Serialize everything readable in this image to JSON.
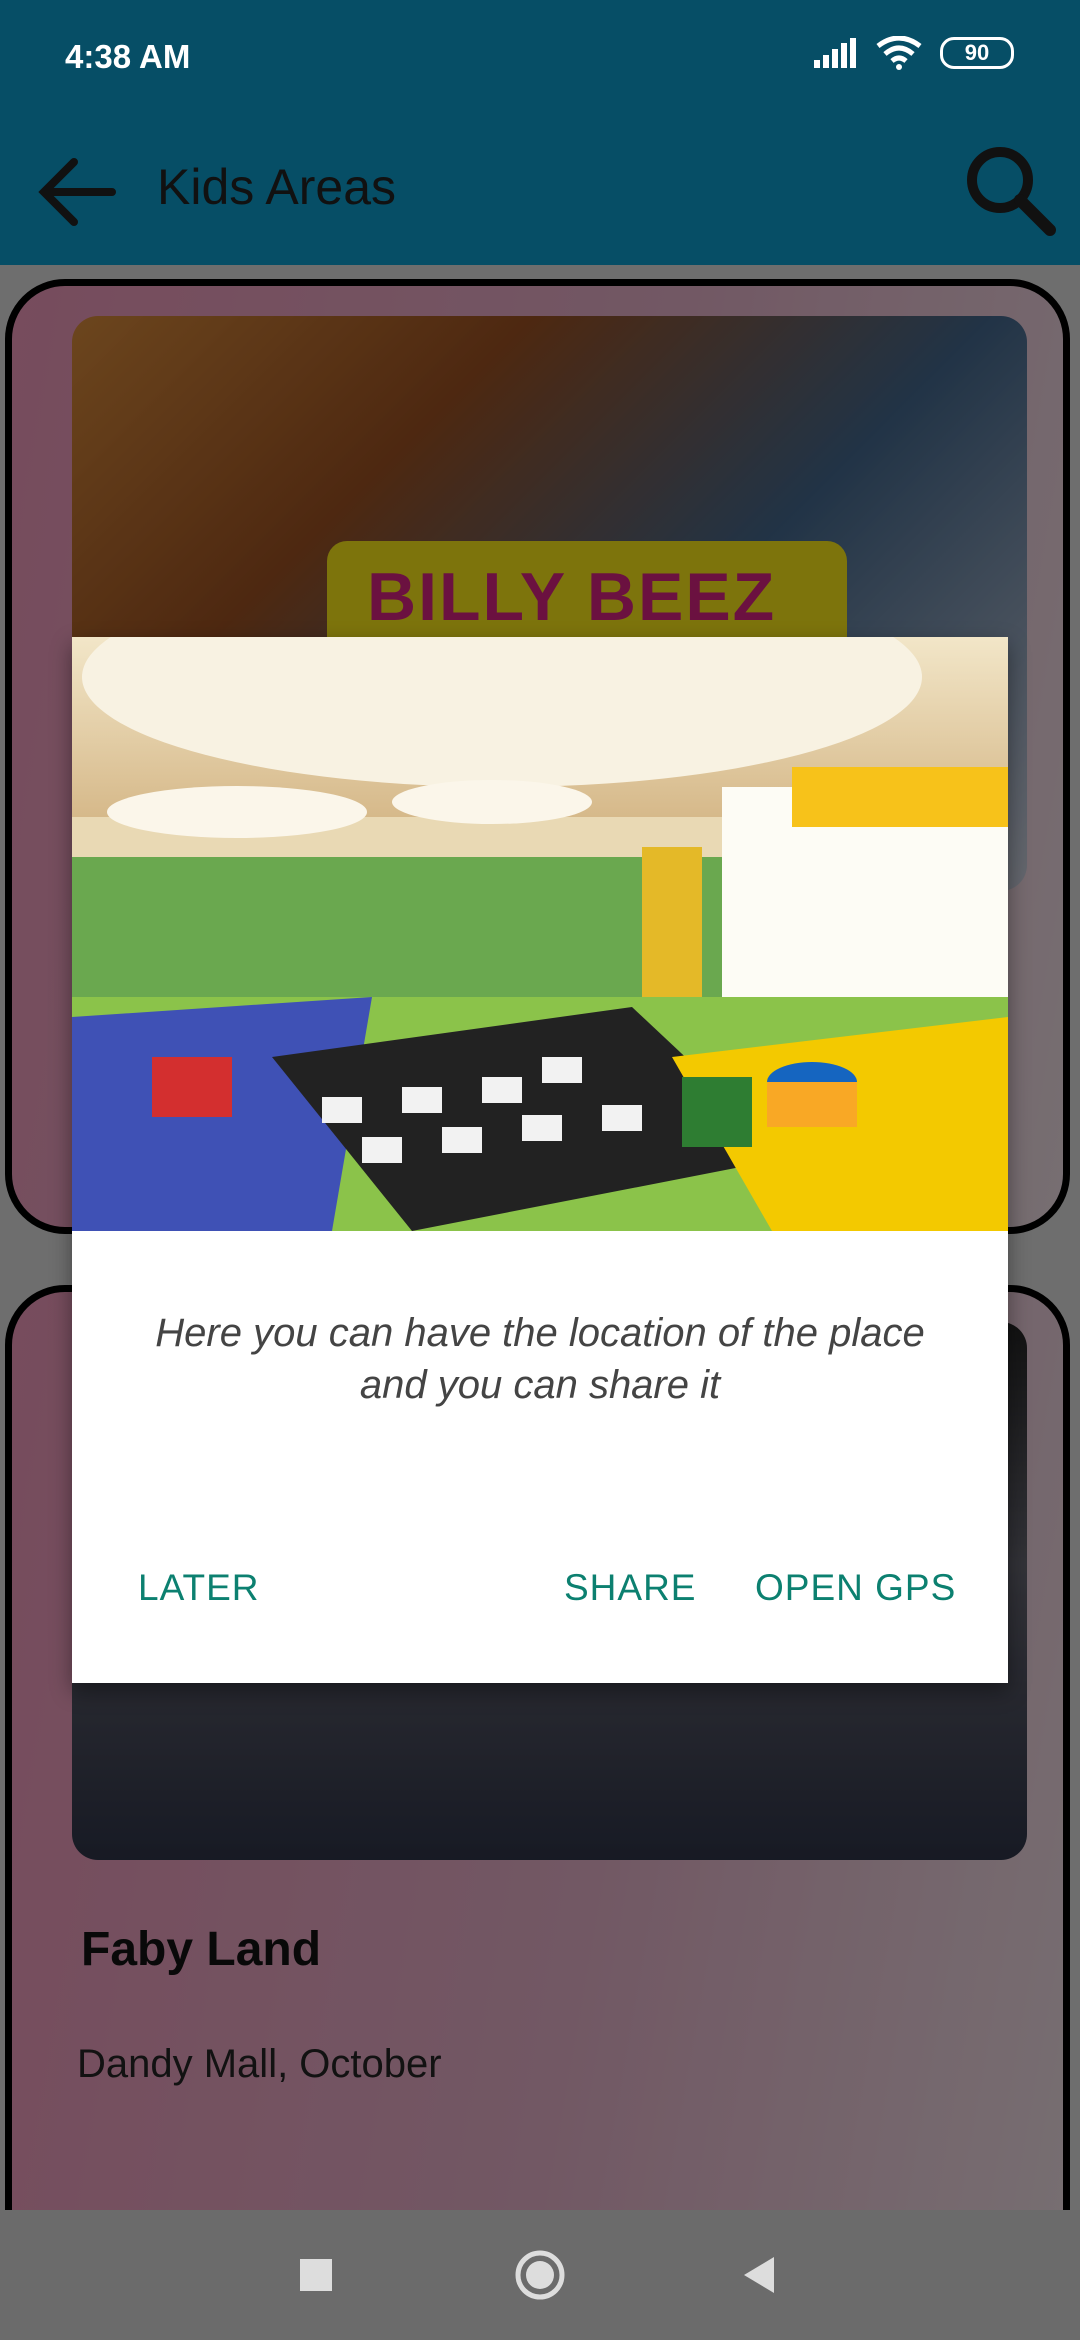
{
  "status": {
    "time": "4:38 AM",
    "battery": "90"
  },
  "app_bar": {
    "title": "Kids Areas"
  },
  "cards": [
    {
      "logo_text": "BILLY BEEZ"
    },
    {
      "title": "Faby Land",
      "subtitle": "Dandy Mall, October"
    }
  ],
  "dialog": {
    "message": "Here you can have the location of the place and you can share it",
    "buttons": {
      "later": "LATER",
      "share": "SHARE",
      "open_gps": "OPEN GPS"
    }
  },
  "colors": {
    "primary": "#064e66",
    "accent": "#0c8070",
    "card_bg": "#d98aa9"
  },
  "icons": [
    "back-arrow-icon",
    "search-icon",
    "signal-icon",
    "wifi-icon",
    "battery-icon",
    "recent-apps-icon",
    "home-icon",
    "back-icon"
  ]
}
